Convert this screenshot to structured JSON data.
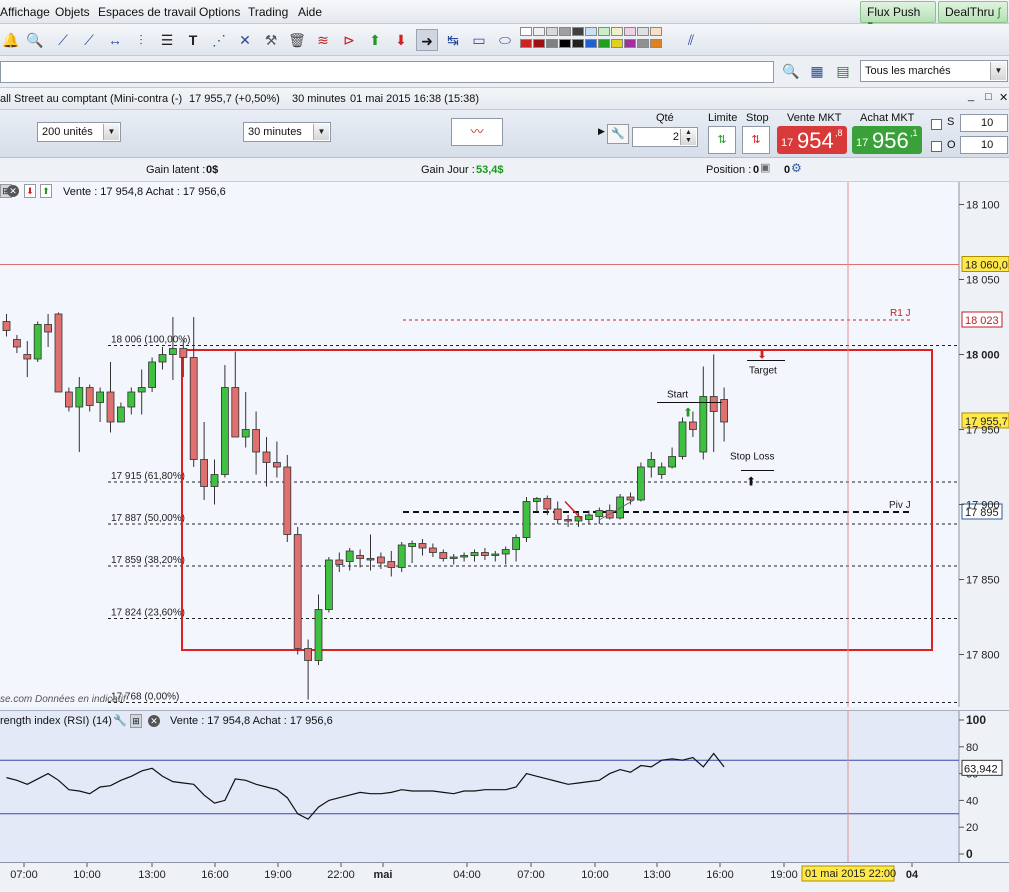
{
  "menu": {
    "items": [
      "Affichage",
      "Objets",
      "Espaces de travail",
      "Options",
      "Trading",
      "Aide"
    ],
    "flux_push": "Flux Push",
    "dealthru": "DealThru"
  },
  "toolbar": {
    "icons": [
      "bell-icon",
      "zoom-icon",
      "line-icon",
      "ray-icon",
      "hline-icon",
      "vline-icon",
      "list-icon",
      "text-icon",
      "pitchfork-icon",
      "tools-icon",
      "trash-icon",
      "fibo-icon",
      "triangle-icon",
      "buy-arrow-icon",
      "sell-arrow-icon",
      "pointer-arrow-icon",
      "measure-icon",
      "rectangle-icon",
      "ellipse-icon",
      "parallel-lines-icon"
    ]
  },
  "search": {
    "value": "",
    "market_filter": "Tous les marchés"
  },
  "window": {
    "title": "all Street au comptant (Mini-contra (-)",
    "price_change": "17 955,7 (+0,50%)",
    "timeframe": "30 minutes",
    "datetime": "01 mai 2015 16:38 (15:38)"
  },
  "order": {
    "units": "200 unités",
    "timeframe": "30 minutes",
    "qty_label": "Qté",
    "qty_value": "2",
    "limit_label": "Limite",
    "stop_label": "Stop",
    "sell_label": "Vente MKT",
    "buy_label": "Achat MKT",
    "sell_prefix": "17",
    "sell_big": "954",
    "sell_sup": ",8",
    "buy_prefix": "17",
    "buy_big": "956",
    "buy_sup": ",1",
    "s_label": "S",
    "o_label": "O",
    "s_value": "10",
    "o_value": "10",
    "sell_color": "#d83a3a",
    "buy_color": "#3aa03a"
  },
  "gains": {
    "latent_label": "Gain latent :",
    "latent_value": "0$",
    "jour_label": "Gain Jour :",
    "jour_value": "53,4$",
    "position_label": "Position :",
    "position_value": "0",
    "position_value2": "0"
  },
  "chart_header": {
    "quote": "Vente : 17 954,8 Achat : 17 956,6"
  },
  "annotations": {
    "r1": "R1 J",
    "piv": "Piv J",
    "start": "Start",
    "target": "Target",
    "stop_loss": "Stop Loss",
    "watermark": "se.com  Données en indicatif"
  },
  "price_tags": {
    "level_18060": "18 060,0",
    "r1": "18 023",
    "last": "17 955,7",
    "piv": "17 895"
  },
  "rsi": {
    "title": "rength index (RSI) (14)",
    "quote": "Vente : 17 954,8 Achat : 17 956,6",
    "value": "63,942",
    "ticks": [
      "100",
      "80",
      "60",
      "40",
      "20",
      "0"
    ]
  },
  "x_axis": {
    "labels": [
      "07:00",
      "10:00",
      "13:00",
      "16:00",
      "19:00",
      "22:00",
      "mai",
      "04:00",
      "07:00",
      "10:00",
      "13:00",
      "16:00",
      "19:00",
      "22:00",
      "04"
    ],
    "cursor_label": "01 mai 2015 22:00"
  },
  "chart_data": [
    {
      "type": "candlestick",
      "title": "",
      "y_ticks": [
        "18 100",
        "18 050",
        "18 000",
        "17 950",
        "17 900",
        "17 850",
        "17 800"
      ],
      "ylim": [
        17765,
        18115
      ],
      "fibonacci": [
        {
          "label": "18 006 (100,00%)",
          "value": 18006
        },
        {
          "label": "17 915 (61,80%)",
          "value": 17915
        },
        {
          "label": "17 887 (50,00%)",
          "value": 17887
        },
        {
          "label": "17 859 (38,20%)",
          "value": 17859
        },
        {
          "label": "17 824 (23,60%)",
          "value": 17824
        },
        {
          "label": "17 768 (0,00%)",
          "value": 17768
        }
      ],
      "levels": {
        "resistance_line": 18060,
        "r1": 18023,
        "pivot": 17895
      },
      "candles": [
        [
          18022,
          18027,
          18012,
          18016
        ],
        [
          18010,
          18013,
          18001,
          18005
        ],
        [
          18000,
          18009,
          17985,
          17997
        ],
        [
          17997,
          18022,
          17995,
          18020
        ],
        [
          18020,
          18027,
          18005,
          18015
        ],
        [
          18027,
          18028,
          17975,
          17975
        ],
        [
          17975,
          17978,
          17962,
          17965
        ],
        [
          17965,
          17985,
          17935,
          17978
        ],
        [
          17978,
          17980,
          17962,
          17966
        ],
        [
          17968,
          17978,
          17955,
          17975
        ],
        [
          17975,
          17995,
          17948,
          17955
        ],
        [
          17955,
          17968,
          17955,
          17965
        ],
        [
          17965,
          17978,
          17960,
          17975
        ],
        [
          17975,
          17990,
          17960,
          17978
        ],
        [
          17978,
          17998,
          17975,
          17995
        ],
        [
          17995,
          18005,
          17990,
          18000
        ],
        [
          18000,
          18025,
          17983,
          18004
        ],
        [
          18004,
          18010,
          17985,
          17998
        ],
        [
          17998,
          18025,
          17925,
          17930
        ],
        [
          17930,
          17955,
          17903,
          17912
        ],
        [
          17912,
          17930,
          17900,
          17920
        ],
        [
          17920,
          17993,
          17918,
          17978
        ],
        [
          17978,
          18002,
          17945,
          17945
        ],
        [
          17945,
          17975,
          17938,
          17950
        ],
        [
          17950,
          17962,
          17920,
          17935
        ],
        [
          17935,
          17945,
          17912,
          17928
        ],
        [
          17928,
          17942,
          17918,
          17925
        ],
        [
          17925,
          17933,
          17875,
          17880
        ],
        [
          17880,
          17885,
          17800,
          17804
        ],
        [
          17804,
          17810,
          17770,
          17796
        ],
        [
          17796,
          17840,
          17793,
          17830
        ],
        [
          17830,
          17865,
          17828,
          17863
        ],
        [
          17863,
          17868,
          17855,
          17860
        ],
        [
          17862,
          17871,
          17856,
          17869
        ],
        [
          17866,
          17870,
          17858,
          17864
        ],
        [
          17864,
          17880,
          17856,
          17864
        ],
        [
          17865,
          17868,
          17857,
          17861
        ],
        [
          17862,
          17869,
          17852,
          17858
        ],
        [
          17858,
          17875,
          17855,
          17873
        ],
        [
          17872,
          17876,
          17861,
          17874
        ],
        [
          17874,
          17877,
          17866,
          17871
        ],
        [
          17871,
          17874,
          17865,
          17868
        ],
        [
          17868,
          17870,
          17862,
          17864
        ],
        [
          17864,
          17867,
          17860,
          17865
        ],
        [
          17865,
          17868,
          17862,
          17866
        ],
        [
          17866,
          17870,
          17862,
          17868
        ],
        [
          17868,
          17871,
          17863,
          17866
        ],
        [
          17866,
          17869,
          17862,
          17867
        ],
        [
          17867,
          17872,
          17860,
          17870
        ],
        [
          17870,
          17880,
          17862,
          17878
        ],
        [
          17878,
          17905,
          17875,
          17902
        ],
        [
          17902,
          17905,
          17895,
          17904
        ],
        [
          17904,
          17906,
          17893,
          17897
        ],
        [
          17897,
          17902,
          17887,
          17890
        ],
        [
          17890,
          17893,
          17885,
          17889
        ],
        [
          17889,
          17895,
          17885,
          17892
        ],
        [
          17890,
          17896,
          17887,
          17893
        ],
        [
          17892,
          17898,
          17887,
          17896
        ],
        [
          17896,
          17900,
          17890,
          17891
        ],
        [
          17891,
          17907,
          17890,
          17905
        ],
        [
          17905,
          17908,
          17900,
          17903
        ],
        [
          17903,
          17928,
          17902,
          17925
        ],
        [
          17925,
          17935,
          17918,
          17930
        ],
        [
          17920,
          17928,
          17917,
          17925
        ],
        [
          17925,
          17938,
          17924,
          17932
        ],
        [
          17932,
          17958,
          17930,
          17955
        ],
        [
          17955,
          17962,
          17945,
          17950
        ],
        [
          17935,
          17992,
          17930,
          17972
        ],
        [
          17972,
          18000,
          17935,
          17962
        ],
        [
          17970,
          17978,
          17942,
          17955
        ]
      ]
    },
    {
      "type": "line",
      "title": "",
      "ylim": [
        0,
        100
      ],
      "reference_lines": [
        30,
        70
      ],
      "values": [
        57,
        55,
        52,
        56,
        60,
        55,
        48,
        47,
        45,
        50,
        51,
        55,
        58,
        62,
        64,
        58,
        54,
        53,
        52,
        44,
        38,
        40,
        56,
        55,
        52,
        50,
        48,
        42,
        30,
        26,
        35,
        40,
        42,
        44,
        46,
        45,
        45,
        46,
        48,
        47,
        47,
        47,
        46,
        45,
        47,
        47,
        48,
        48,
        48,
        50,
        60,
        58,
        56,
        54,
        52,
        53,
        54,
        55,
        60,
        63,
        61,
        66,
        65,
        70,
        71,
        70,
        72,
        65,
        75,
        65
      ]
    }
  ]
}
